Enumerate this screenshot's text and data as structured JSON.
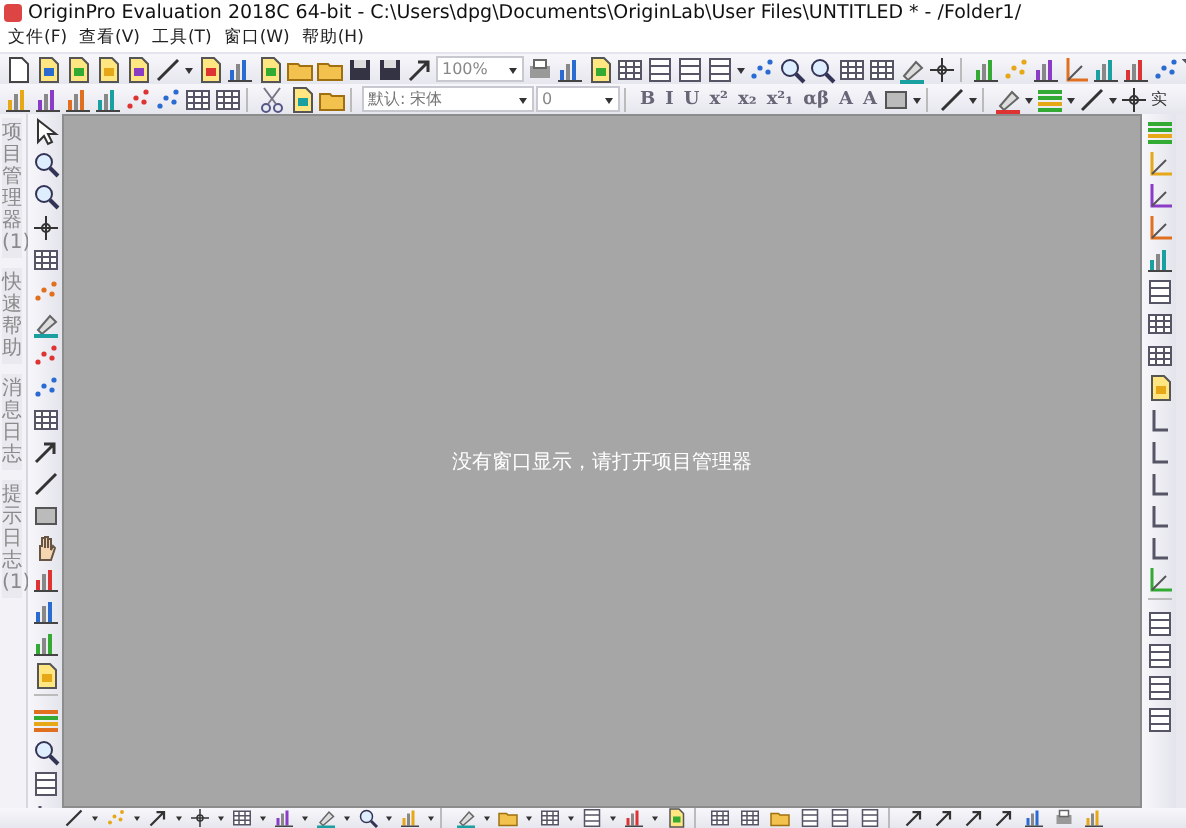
{
  "window": {
    "title": "OriginPro Evaluation 2018C 64-bit - C:\\Users\\dpg\\Documents\\OriginLab\\User Files\\UNTITLED * - /Folder1/"
  },
  "menu": [
    "文件(F)",
    "查看(V)",
    "工具(T)",
    "窗口(W)",
    "帮助(H)"
  ],
  "toolbar": {
    "zoom_combo": "100%",
    "font_combo": "默认: 宋体",
    "size_combo": "0",
    "format_buttons": [
      "B",
      "I",
      "U",
      "x²",
      "x₂",
      "x²₁",
      "αβ",
      "A",
      "A"
    ],
    "line_style": "实"
  },
  "side_tabs": [
    "项目管理器 (1)",
    "快速帮助",
    "消息日志",
    "提示日志 (1)"
  ],
  "workspace": {
    "message": "没有窗口显示，请打开项目管理器"
  }
}
